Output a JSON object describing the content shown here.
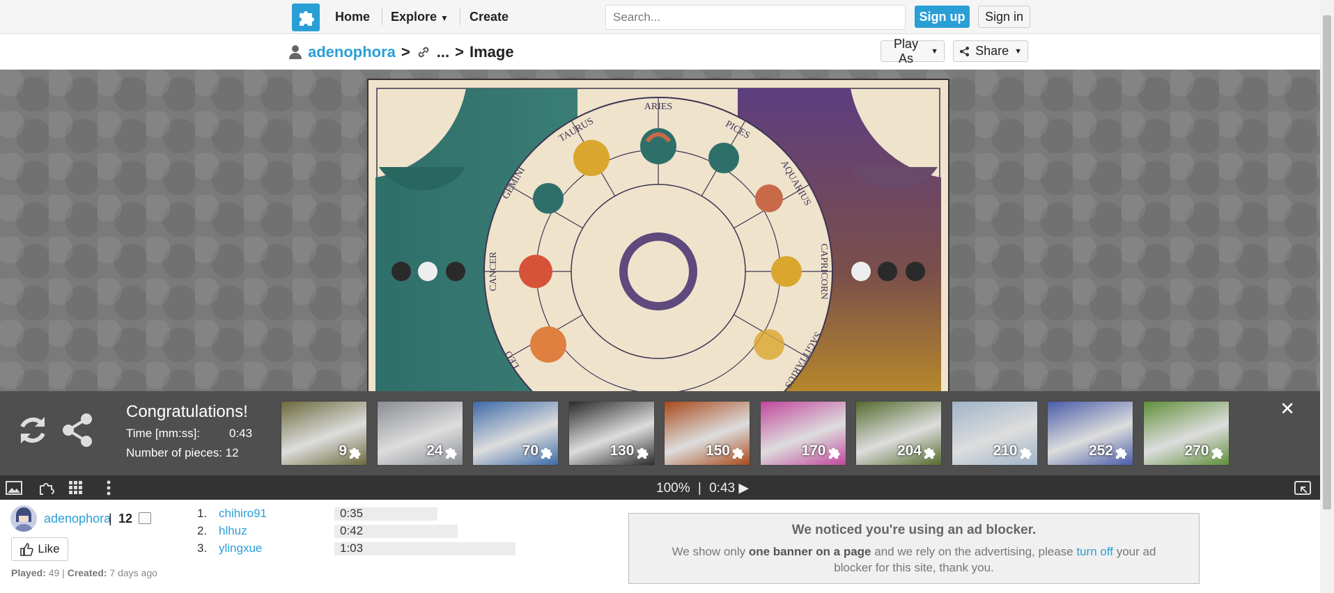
{
  "nav": {
    "home": "Home",
    "explore": "Explore",
    "create": "Create",
    "search_placeholder": "Search...",
    "signup": "Sign up",
    "signin": "Sign in"
  },
  "breadcrumb": {
    "user": "adenophora",
    "sep1": ">",
    "ellipsis": "...",
    "sep2": ">",
    "current": "Image"
  },
  "actions": {
    "play_as": "Play As",
    "share": "Share"
  },
  "puzzle": {
    "signs": [
      "ARIES",
      "PICES",
      "AQUARIUS",
      "CAPRICORN",
      "SAGITTARIUS",
      "LEO",
      "CANCER",
      "GEMINI",
      "TAURUS"
    ]
  },
  "congrats": {
    "title": "Congratulations!",
    "time_label": "Time [mm:ss]:",
    "time_value": "0:43",
    "pieces_label": "Number of pieces: 12"
  },
  "piece_options": [
    {
      "count": "9",
      "color": "#6b6a3c"
    },
    {
      "count": "24",
      "color": "#8a8d94"
    },
    {
      "count": "70",
      "color": "#3d6aa8"
    },
    {
      "count": "130",
      "color": "#2b2b2b"
    },
    {
      "count": "150",
      "color": "#a84a1c"
    },
    {
      "count": "170",
      "color": "#c2479c"
    },
    {
      "count": "204",
      "color": "#556b2f"
    },
    {
      "count": "210",
      "color": "#9fb4c8"
    },
    {
      "count": "252",
      "color": "#4a5ca8"
    },
    {
      "count": "270",
      "color": "#5f8f3a"
    }
  ],
  "toolbar": {
    "zoom": "100%",
    "separator": "|",
    "timer": "0:43 ▶"
  },
  "owner": {
    "name": "adenophora",
    "divider": "|",
    "count": "12",
    "like": "Like",
    "played_label": "Played:",
    "played_value": "49",
    "created_label": "Created:",
    "created_value": "7 days ago"
  },
  "scores": [
    {
      "rank": "1.",
      "name": "chihiro91",
      "time": "0:35",
      "bar": 0.57
    },
    {
      "rank": "2.",
      "name": "hlhuz",
      "time": "0:42",
      "bar": 0.68
    },
    {
      "rank": "3.",
      "name": "ylingxue",
      "time": "1:03",
      "bar": 1.0
    }
  ],
  "adblock": {
    "title": "We noticed you're using an ad blocker.",
    "text1": "We show only ",
    "bold": "one banner on a page",
    "text2": " and we rely on the advertising, please ",
    "link": "turn off",
    "text3": " your ad blocker for this site, thank you."
  },
  "colors": {
    "accent": "#2a9fd6",
    "board": "#7a7a7a",
    "overlay": "#282828"
  }
}
